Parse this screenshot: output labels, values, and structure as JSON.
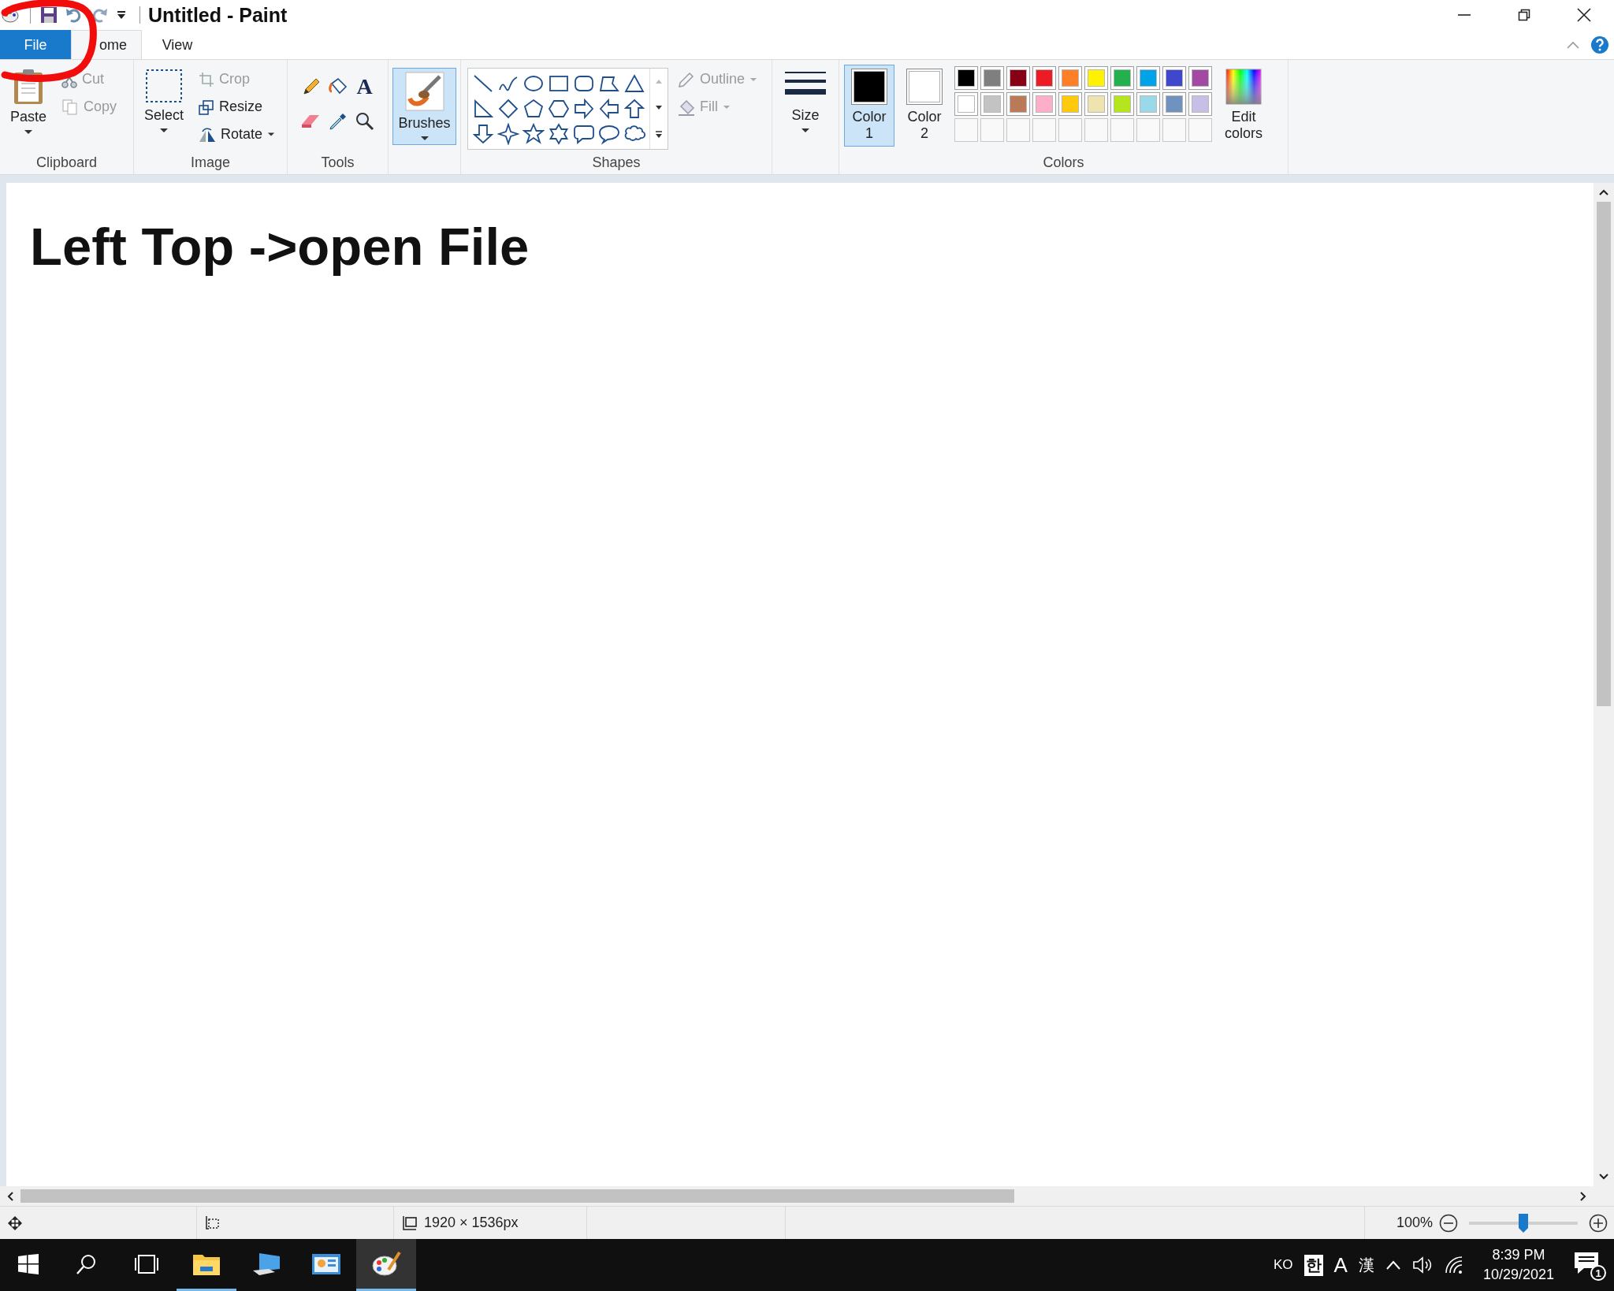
{
  "window": {
    "title": "Untitled - Paint"
  },
  "tabs": [
    {
      "label": "File",
      "kind": "file",
      "selected": false
    },
    {
      "label": "ome",
      "kind": "tab",
      "selected": true
    },
    {
      "label": "View",
      "kind": "tab",
      "selected": false
    }
  ],
  "ribbon": {
    "clipboard": {
      "label": "Clipboard",
      "paste": "Paste",
      "cut": {
        "label": "Cut",
        "disabled": true
      },
      "copy": {
        "label": "Copy",
        "disabled": true
      }
    },
    "image": {
      "label": "Image",
      "select": "Select",
      "crop": "Crop",
      "resize": "Resize",
      "rotate": "Rotate"
    },
    "tools": {
      "label": "Tools",
      "text_glyph": "A"
    },
    "brushes": {
      "label": "Brushes",
      "selected": true
    },
    "shapes": {
      "label": "Shapes",
      "outline": {
        "label": "Outline",
        "disabled": true
      },
      "fill": {
        "label": "Fill",
        "disabled": true
      }
    },
    "size": {
      "label": "Size"
    },
    "colors": {
      "label": "Colors",
      "color1": {
        "label": "Color 1",
        "color": "#000000",
        "selected": true
      },
      "color2": {
        "label": "Color 2",
        "color": "#ffffff",
        "selected": false
      },
      "palette": [
        {
          "color": "#000000"
        },
        {
          "color": "#7f7f7f"
        },
        {
          "color": "#880015"
        },
        {
          "color": "#ed1c24"
        },
        {
          "color": "#ff7f27"
        },
        {
          "color": "#fff200"
        },
        {
          "color": "#22b14c"
        },
        {
          "color": "#00a2e8"
        },
        {
          "color": "#3f48cc"
        },
        {
          "color": "#a349a4"
        },
        {
          "color": "#ffffff"
        },
        {
          "color": "#c3c3c3"
        },
        {
          "color": "#b97a57"
        },
        {
          "color": "#ffaec9"
        },
        {
          "color": "#ffc90e"
        },
        {
          "color": "#efe4b0"
        },
        {
          "color": "#b5e61d"
        },
        {
          "color": "#99d9ea"
        },
        {
          "color": "#7092be"
        },
        {
          "color": "#c8bfe7"
        }
      ],
      "edit": "Edit colors"
    }
  },
  "canvas": {
    "text": "Left Top ->open File"
  },
  "annotation": {
    "kind": "circle"
  },
  "status_bar": {
    "size": "1920 × 1536px",
    "zoom": {
      "reading": "100%",
      "level": 0.5
    }
  },
  "taskbar": {
    "apps": [
      {
        "kind": "explorer",
        "running": true,
        "active": false
      },
      {
        "kind": "computer",
        "running": false,
        "active": false
      },
      {
        "kind": "control",
        "running": false,
        "active": false
      },
      {
        "kind": "paint",
        "running": true,
        "active": true
      }
    ],
    "tray": {
      "language": "KO",
      "ime_mode": "한",
      "input": "A",
      "hanja": "漢",
      "time": "8:39 PM",
      "date": "10/29/2021",
      "notifications": "1"
    }
  }
}
